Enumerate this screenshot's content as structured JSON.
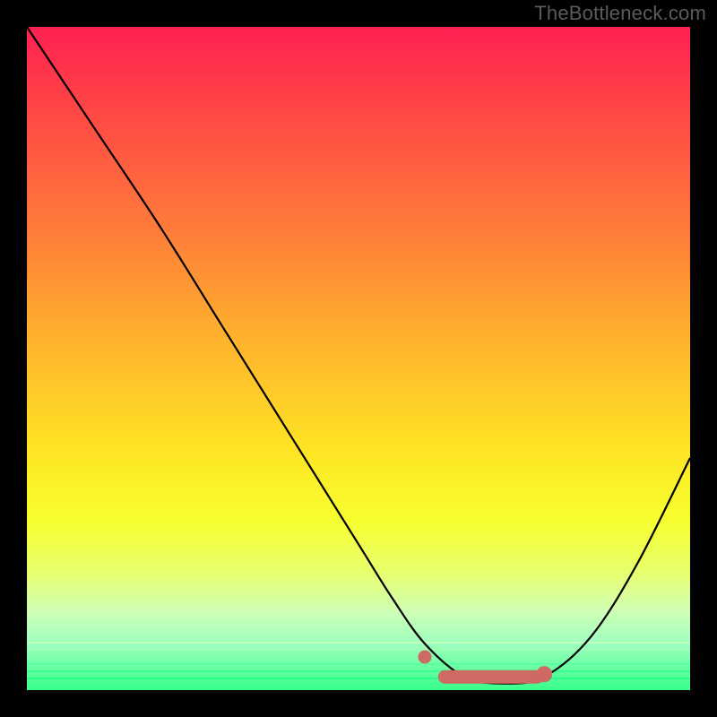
{
  "watermark": "TheBottleneck.com",
  "colors": {
    "curve": "#000000",
    "marker_fill": "#cc6a63",
    "marker_stroke": "#cc6a63",
    "frame_bg": "#000000"
  },
  "chart_data": {
    "type": "line",
    "title": "",
    "xlabel": "",
    "ylabel": "",
    "xlim": [
      0,
      100
    ],
    "ylim": [
      0,
      100
    ],
    "grid": false,
    "legend": false,
    "series": [
      {
        "name": "bottleneck-curve",
        "x": [
          0,
          10,
          20,
          30,
          40,
          50,
          55,
          60,
          66,
          72,
          78,
          85,
          92,
          100
        ],
        "values": [
          100,
          85,
          70,
          54,
          38,
          22,
          14,
          7,
          2,
          1,
          2,
          8,
          19,
          35
        ]
      }
    ],
    "markers": [
      {
        "name": "optimal-dot",
        "x": 60,
        "y": 5,
        "shape": "circle"
      },
      {
        "name": "optimal-range-bar",
        "x_start": 62,
        "x_end": 78,
        "y": 2,
        "shape": "rounded-bar"
      }
    ],
    "notes": "No axes, ticks, or labels visible. Background is vertical rainbow gradient red→green. Curve is a V-shape with minimum near x≈70. Salmon-colored dot and thick bar mark optimal region near the minimum."
  }
}
